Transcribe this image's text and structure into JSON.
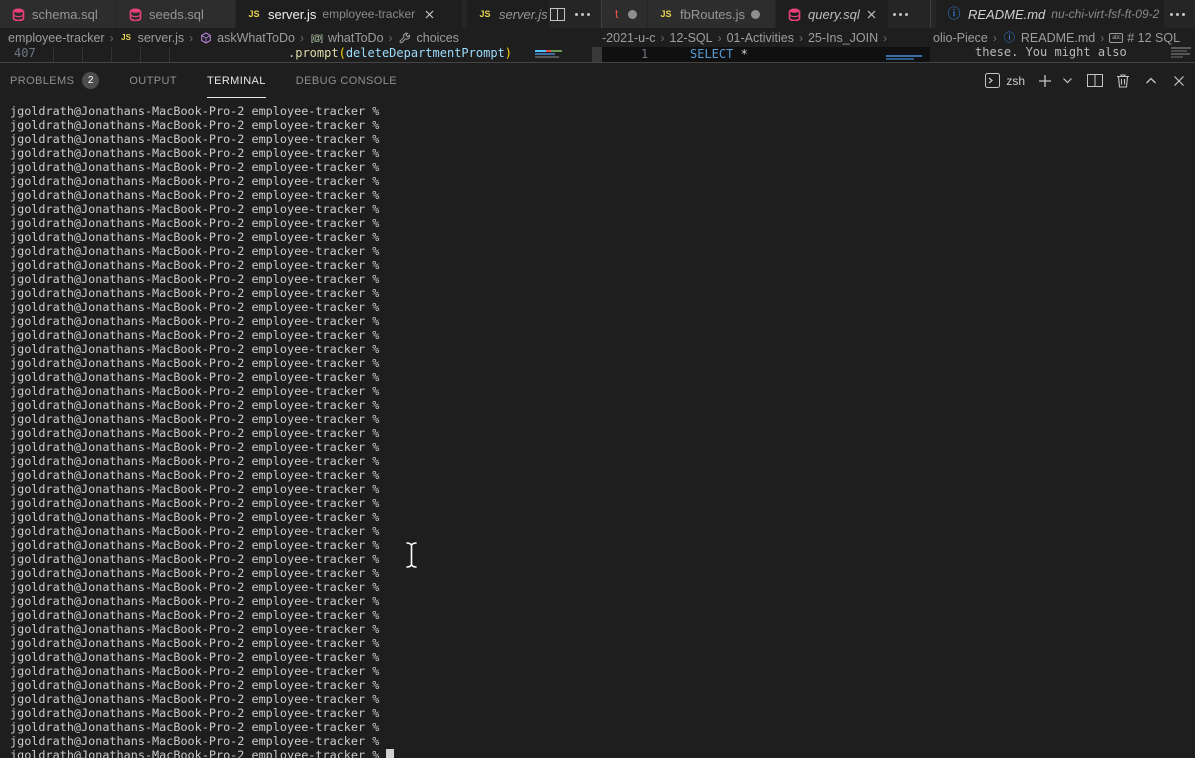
{
  "tab_groups": {
    "group1": {
      "tabs": [
        {
          "label": "schema.sql",
          "icon": "database"
        },
        {
          "label": "seeds.sql",
          "icon": "database"
        },
        {
          "label": "server.js",
          "description": "employee-tracker",
          "icon": "js",
          "active": true
        }
      ]
    },
    "group2": {
      "tabs": [
        {
          "label": "server.js",
          "icon": "js",
          "preview": true
        }
      ]
    },
    "group3": {
      "tabs": [
        {
          "label_fragment": "t",
          "modified": true
        },
        {
          "label": "fbRoutes.js",
          "icon": "js",
          "modified": true
        },
        {
          "label": "query.sql",
          "icon": "database",
          "preview": true
        }
      ]
    },
    "group4": {
      "tabs": [
        {
          "label": "README.md",
          "description": "nu-chi-virt-fsf-ft-09-2",
          "icon": "info",
          "preview": true
        }
      ]
    }
  },
  "breadcrumbs": {
    "group1": [
      {
        "label": "employee-tracker"
      },
      {
        "label": "server.js",
        "icon": "js"
      },
      {
        "label": "askWhatToDo",
        "icon": "symbol-namespace"
      },
      {
        "label": "whatToDo",
        "icon": "symbol-event"
      },
      {
        "label": "choices",
        "icon": "symbol-property"
      }
    ],
    "group3": [
      {
        "label": "-2021-u-c"
      },
      {
        "label": "12-SQL"
      },
      {
        "label": "01-Activities"
      },
      {
        "label": "25-Ins_JOIN"
      }
    ],
    "group4": [
      {
        "label": "olio-Piece"
      },
      {
        "label": "README.md",
        "icon": "info"
      },
      {
        "label": "# 12 SQL",
        "icon": "symbol-string"
      }
    ]
  },
  "editors": {
    "group1_code": {
      "line_number": "407",
      "tokens": [
        {
          "text": ".",
          "color": "#d4d4d4"
        },
        {
          "text": "prompt",
          "color": "#dcdcaa"
        },
        {
          "text": "(",
          "color": "#ffd700"
        },
        {
          "text": "deleteDepartmentPrompt",
          "color": "#9cdcfe"
        },
        {
          "text": ")",
          "color": "#ffd700"
        }
      ]
    },
    "group3_code": {
      "line_number": "1",
      "tokens": [
        {
          "text": "SELECT",
          "color": "#569cd6"
        },
        {
          "text": " *",
          "color": "#d4d4d4"
        }
      ]
    },
    "group4_text": "these. You might also"
  },
  "panel": {
    "tabs": [
      {
        "label": "PROBLEMS",
        "badge": "2"
      },
      {
        "label": "OUTPUT"
      },
      {
        "label": "TERMINAL",
        "active": true
      },
      {
        "label": "DEBUG CONSOLE"
      }
    ],
    "shell_label": "zsh"
  },
  "terminal": {
    "prompt_line": "jgoldrath@Jonathans-MacBook-Pro-2 employee-tracker %",
    "line_count": 47
  },
  "colors": {
    "tab_bar_bg": "#252526",
    "tab_inactive_bg": "#2d2d2d",
    "editor_bg": "#1e1e1e",
    "js_icon_yellow": "#e8d44d",
    "database_icon_pink": "#ec407a",
    "info_icon_blue": "#3794ff",
    "terminal_fg": "#cccccc",
    "keyword_blue": "#569cd6",
    "function_yellow": "#dcdcaa",
    "variable_blue": "#9cdcfe"
  }
}
